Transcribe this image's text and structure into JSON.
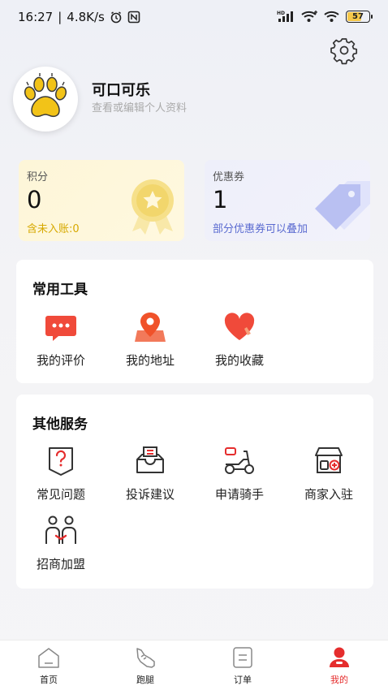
{
  "status_bar": {
    "time": "16:27",
    "net_speed": "4.8K/s",
    "signal": "HD",
    "battery": "57"
  },
  "icons": {
    "settings": "gear-icon",
    "avatar": "paw-icon"
  },
  "profile": {
    "nickname": "可口可乐",
    "subtitle": "查看或编辑个人资料"
  },
  "points": {
    "label": "积分",
    "value": "0",
    "note": "含未入账:0"
  },
  "coupon": {
    "label": "优惠券",
    "value": "1",
    "note": "部分优惠券可以叠加"
  },
  "tools": {
    "title": "常用工具",
    "items": [
      {
        "label": "我的评价",
        "icon": "comment-icon"
      },
      {
        "label": "我的地址",
        "icon": "location-icon"
      },
      {
        "label": "我的收藏",
        "icon": "heart-icon"
      }
    ]
  },
  "services": {
    "title": "其他服务",
    "items": [
      {
        "label": "常见问题",
        "icon": "question-icon"
      },
      {
        "label": "投诉建议",
        "icon": "mailbox-icon"
      },
      {
        "label": "申请骑手",
        "icon": "scooter-icon"
      },
      {
        "label": "商家入驻",
        "icon": "store-icon"
      },
      {
        "label": "招商加盟",
        "icon": "partners-icon"
      }
    ]
  },
  "nav": {
    "items": [
      {
        "label": "首页",
        "icon": "home-icon"
      },
      {
        "label": "跑腿",
        "icon": "shoe-icon"
      },
      {
        "label": "订单",
        "icon": "order-icon"
      },
      {
        "label": "我的",
        "icon": "user-icon",
        "active": true
      }
    ]
  },
  "colors": {
    "accent": "#e52d2d",
    "points_note": "#d7a900",
    "coupon_note": "#5a6ad0"
  }
}
